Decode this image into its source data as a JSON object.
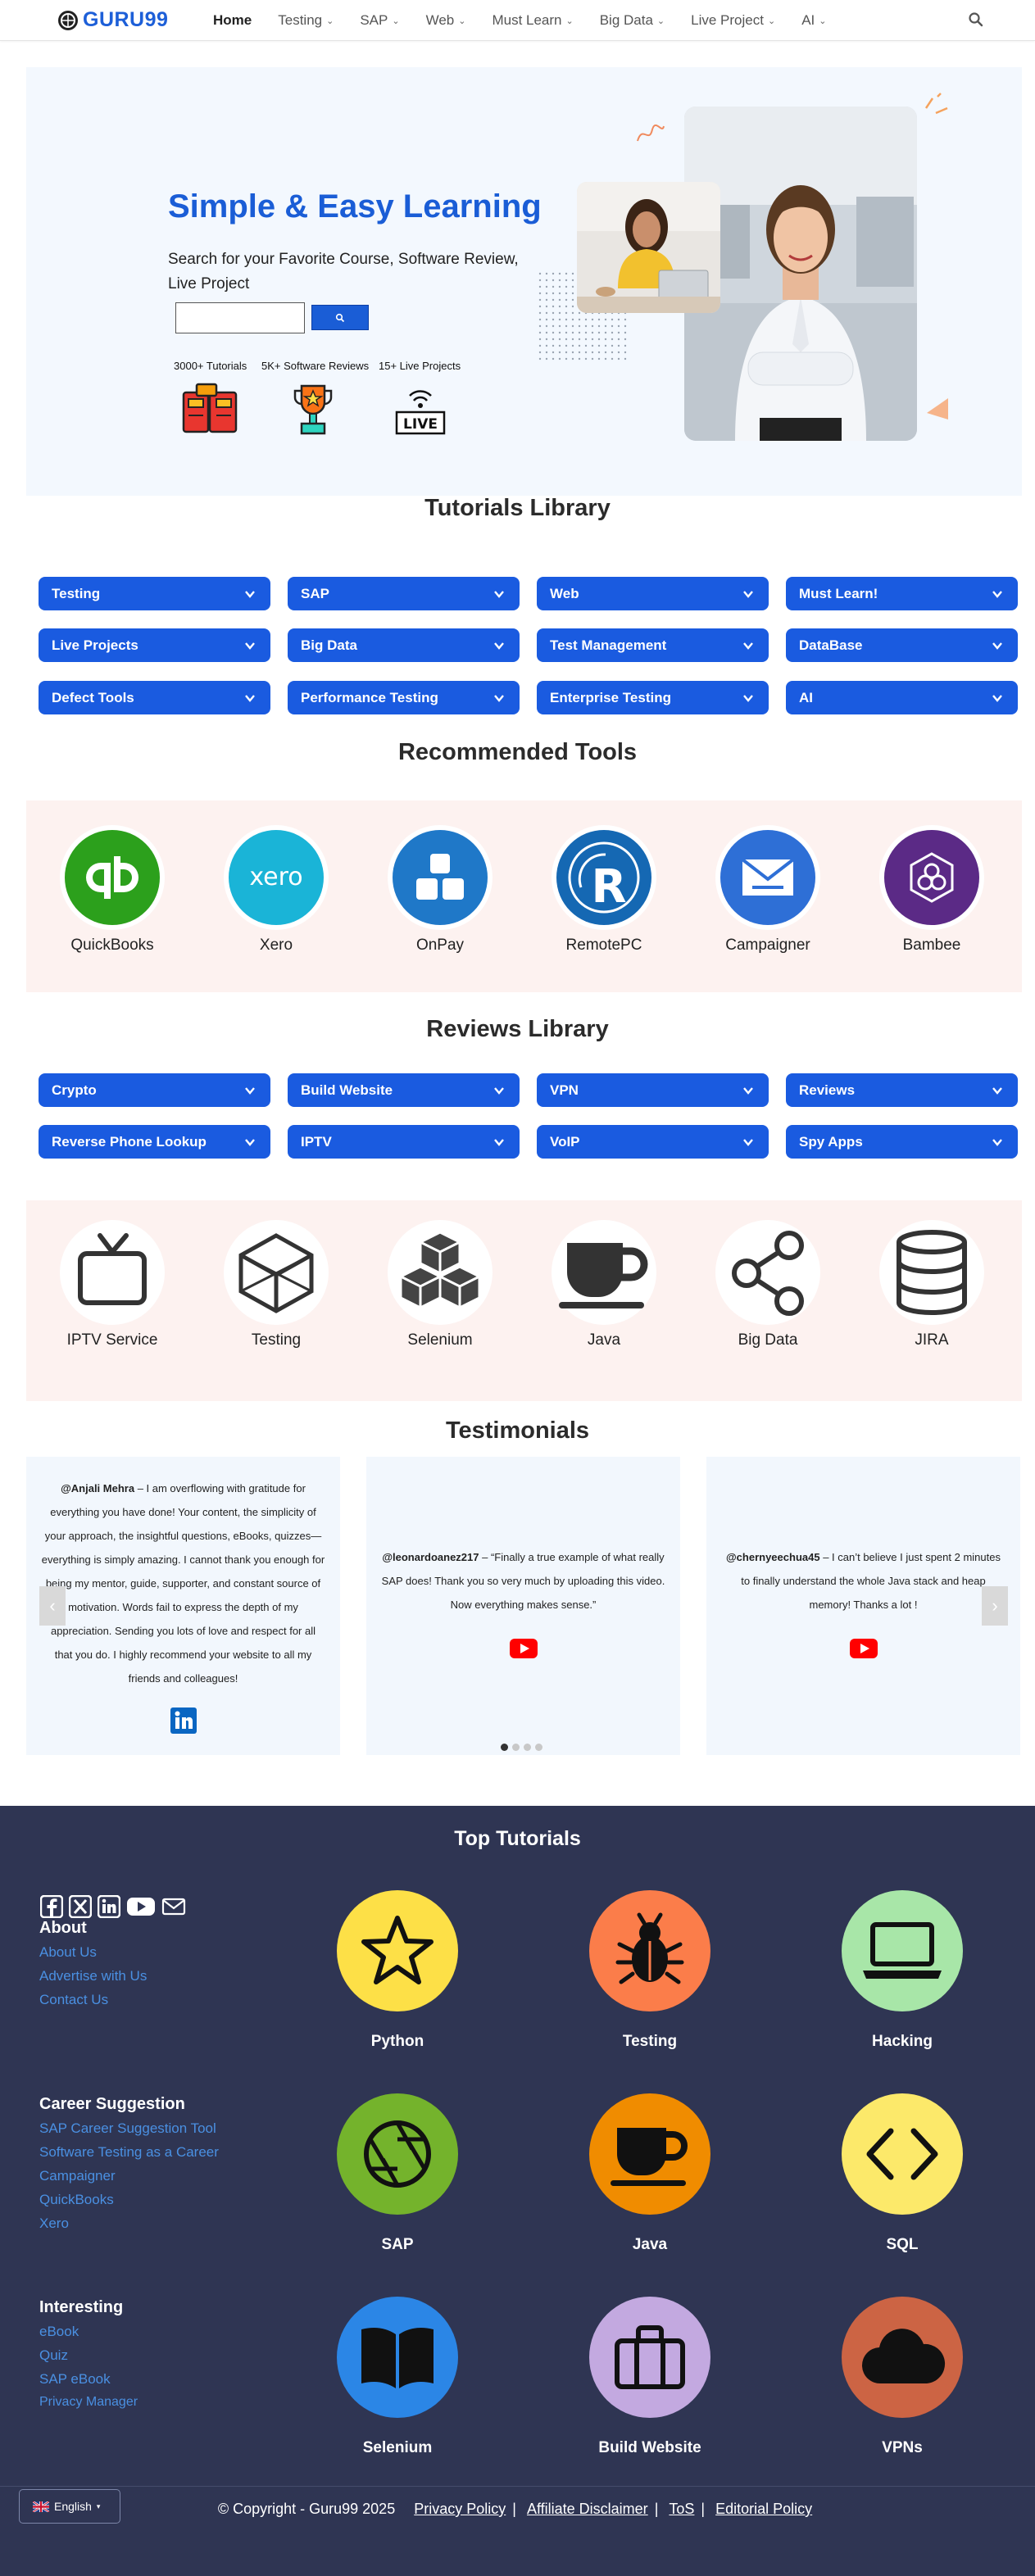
{
  "nav": {
    "logo": "GURU99",
    "items": [
      {
        "label": "Home",
        "active": true,
        "dropdown": false
      },
      {
        "label": "Testing",
        "dropdown": true
      },
      {
        "label": "SAP",
        "dropdown": true
      },
      {
        "label": "Web",
        "dropdown": true
      },
      {
        "label": "Must Learn",
        "dropdown": true
      },
      {
        "label": "Big Data",
        "dropdown": true
      },
      {
        "label": "Live Project",
        "dropdown": true
      },
      {
        "label": "AI",
        "dropdown": true
      }
    ],
    "search_icon": "search-icon"
  },
  "hero": {
    "title": "Simple & Easy Learning",
    "subtitle": "Search for your Favorite Course, Software Review, Live Project",
    "search_placeholder": "",
    "stats": [
      {
        "label": "3000+ Tutorials",
        "icon": "books-icon"
      },
      {
        "label": "5K+ Software Reviews",
        "icon": "trophy-icon"
      },
      {
        "label": "15+ Live Projects",
        "icon": "live-icon"
      }
    ]
  },
  "tutorials": {
    "title": "Tutorials Library",
    "items": [
      "Testing",
      "SAP",
      "Web",
      "Must Learn!",
      "Live Projects",
      "Big Data",
      "Test Management",
      "DataBase",
      "Defect Tools",
      "Performance Testing",
      "Enterprise Testing",
      "AI"
    ]
  },
  "tools": {
    "title": "Recommended Tools",
    "items": [
      {
        "label": "QuickBooks",
        "color": "#2ca01c"
      },
      {
        "label": "Xero",
        "color": "#1ab4d7"
      },
      {
        "label": "OnPay",
        "color": "#1f78c8"
      },
      {
        "label": "RemotePC",
        "color": "#1568b3"
      },
      {
        "label": "Campaigner",
        "color": "#2e6fd6"
      },
      {
        "label": "Bambee",
        "color": "#5b2a86"
      }
    ]
  },
  "reviews": {
    "title": "Reviews Library",
    "items": [
      "Crypto",
      "Build Website",
      "VPN",
      "Reviews",
      "Reverse Phone Lookup",
      "IPTV",
      "VoIP",
      "Spy Apps"
    ]
  },
  "topics_band": {
    "items": [
      {
        "label": "IPTV Service",
        "icon": "tv-icon"
      },
      {
        "label": "Testing",
        "icon": "cube-icon"
      },
      {
        "label": "Selenium",
        "icon": "cubes-icon"
      },
      {
        "label": "Java",
        "icon": "coffee-icon"
      },
      {
        "label": "Big Data",
        "icon": "share-icon"
      },
      {
        "label": "JIRA",
        "icon": "database-icon"
      }
    ]
  },
  "testimonials": {
    "title": "Testimonials",
    "items": [
      {
        "author": "@Anjali Mehra",
        "text": " – I am overflowing with gratitude for everything you have done! Your content, the simplicity of your approach, the insightful questions, eBooks, quizzes—everything is simply amazing. I cannot thank you enough for being my mentor, guide, supporter, and constant source of motivation. Words fail to express the depth of my appreciation. Sending you lots of love and respect for all that you do. I highly recommend your website to all my friends and colleagues!",
        "source": "linkedin-icon"
      },
      {
        "author": "@leonardoanez217",
        "text": " – “Finally a true example of what really SAP does! Thank you so very much by uploading this video. Now everything makes sense.”",
        "source": "youtube-icon"
      },
      {
        "author": "@chernyeechua45",
        "text": " – I can’t believe I just spent 2 minutes to finally understand the whole Java stack and heap memory! Thanks a lot !",
        "source": "youtube-icon"
      }
    ],
    "pages": 4,
    "active_page": 1
  },
  "footer": {
    "title": "Top Tutorials",
    "about": {
      "heading": "About",
      "links": [
        "About Us",
        "Advertise with Us",
        "Contact Us"
      ]
    },
    "career": {
      "heading": "Career Suggestion",
      "links": [
        "SAP Career Suggestion Tool",
        "Software Testing as a Career",
        "Campaigner",
        "QuickBooks",
        "Xero"
      ]
    },
    "interesting": {
      "heading": "Interesting",
      "links": [
        "eBook",
        "Quiz",
        "SAP eBook",
        "Privacy Manager"
      ]
    },
    "topics": [
      {
        "label": "Python",
        "color": "#fde047",
        "icon": "star-icon"
      },
      {
        "label": "Testing",
        "color": "#fb7d4a",
        "icon": "bug-icon"
      },
      {
        "label": "Hacking",
        "color": "#a8e6a8",
        "icon": "laptop-icon"
      },
      {
        "label": "SAP",
        "color": "#74b32c",
        "icon": "aperture-icon"
      },
      {
        "label": "Java",
        "color": "#f08c00",
        "icon": "coffee-icon"
      },
      {
        "label": "SQL",
        "color": "#fce96a",
        "icon": "code-icon"
      },
      {
        "label": "Selenium",
        "color": "#2b86e6",
        "icon": "book-icon"
      },
      {
        "label": "Build Website",
        "color": "#c3a9e0",
        "icon": "briefcase-icon"
      },
      {
        "label": "VPNs",
        "color": "#cc6444",
        "icon": "cloud-icon"
      }
    ],
    "language": "English",
    "copyright": "© Copyright - Guru99 2025",
    "legal_links": [
      "Privacy Policy",
      "Affiliate Disclaimer",
      "ToS",
      "Editorial Policy"
    ]
  }
}
